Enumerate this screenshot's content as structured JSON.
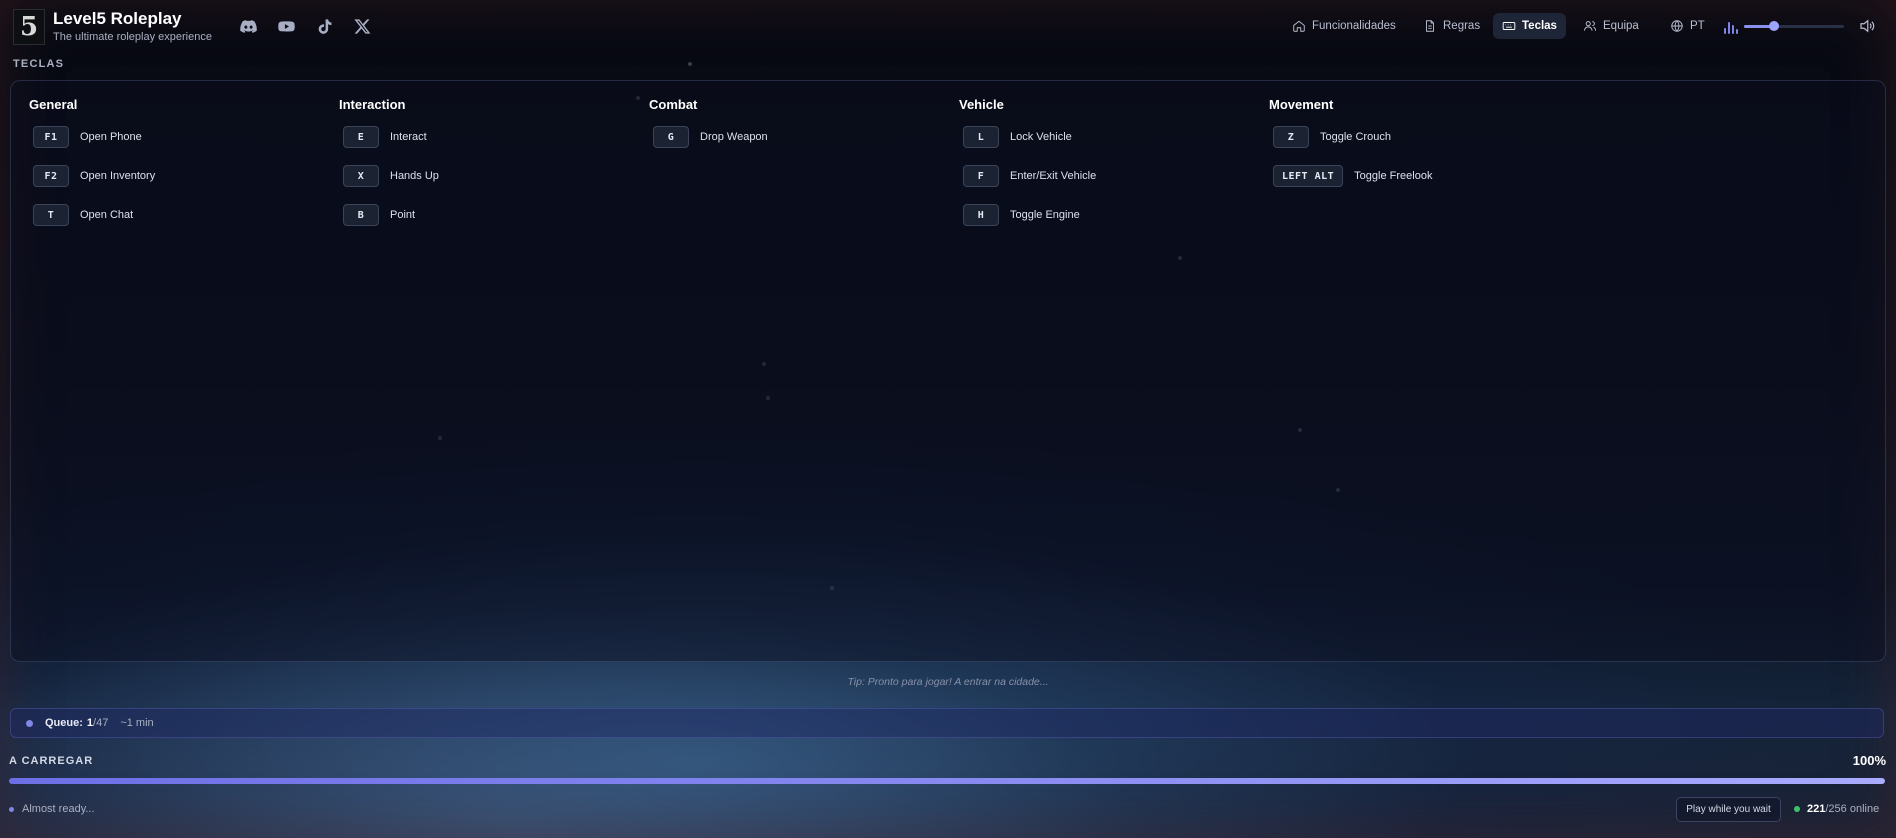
{
  "header": {
    "logo_mark": "5",
    "title": "Level5 Roleplay",
    "subtitle": "The ultimate roleplay experience",
    "socials": [
      {
        "name": "discord",
        "icon": "discord-icon"
      },
      {
        "name": "youtube",
        "icon": "youtube-icon"
      },
      {
        "name": "tiktok",
        "icon": "tiktok-icon"
      },
      {
        "name": "x",
        "icon": "x-icon"
      }
    ],
    "nav": [
      {
        "label": "Funcionalidades",
        "icon": "home-icon",
        "active": false
      },
      {
        "label": "Regras",
        "icon": "document-icon",
        "active": false
      },
      {
        "label": "Teclas",
        "icon": "keyboard-icon",
        "active": true
      },
      {
        "label": "Equipa",
        "icon": "users-icon",
        "active": false
      },
      {
        "label": "PT",
        "icon": "globe-icon",
        "active": false
      }
    ],
    "volume": 0.3
  },
  "section_label": "TECLAS",
  "keybind_groups": [
    {
      "title": "General",
      "binds": [
        {
          "key": "F1",
          "action": "Open Phone"
        },
        {
          "key": "F2",
          "action": "Open Inventory"
        },
        {
          "key": "T",
          "action": "Open Chat"
        }
      ]
    },
    {
      "title": "Interaction",
      "binds": [
        {
          "key": "E",
          "action": "Interact"
        },
        {
          "key": "X",
          "action": "Hands Up"
        },
        {
          "key": "B",
          "action": "Point"
        }
      ]
    },
    {
      "title": "Combat",
      "binds": [
        {
          "key": "G",
          "action": "Drop Weapon"
        }
      ]
    },
    {
      "title": "Vehicle",
      "binds": [
        {
          "key": "L",
          "action": "Lock Vehicle"
        },
        {
          "key": "F",
          "action": "Enter/Exit Vehicle"
        },
        {
          "key": "H",
          "action": "Toggle Engine"
        }
      ]
    },
    {
      "title": "Movement",
      "binds": [
        {
          "key": "Z",
          "action": "Toggle Crouch"
        },
        {
          "key": "LEFT ALT",
          "action": "Toggle Freelook"
        }
      ]
    }
  ],
  "tip": "Tip: Pronto para jogar! A entrar na cidade...",
  "queue": {
    "label": "Queue:",
    "position": "1",
    "total": "/47",
    "eta": "~1 min"
  },
  "loading": {
    "label": "A CARREGAR",
    "percent_text": "100%",
    "progress": 1.0,
    "status": "Almost ready..."
  },
  "play_button_label": "Play while you wait",
  "online": {
    "count": "221",
    "max": "/256",
    "suffix": " online"
  },
  "colors": {
    "accent": "#7f86e6",
    "online": "#3fc36a",
    "active_nav_bg": "#1e2536"
  }
}
